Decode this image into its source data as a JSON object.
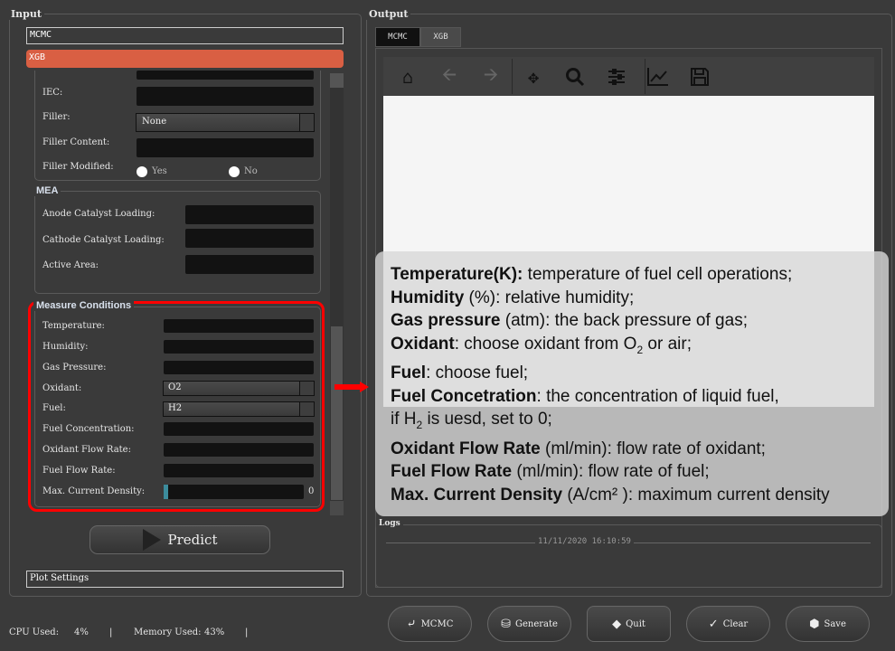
{
  "input": {
    "title": "Input",
    "models": [
      "MCMC",
      "XGB"
    ],
    "membrane": {
      "iec_label": "IEC:",
      "filler_label": "Filler:",
      "filler_value": "None",
      "filler_content_label": "Filler Content:",
      "filler_modified_label": "Filler Modified:",
      "yes": "Yes",
      "no": "No"
    },
    "mea": {
      "title": "MEA",
      "anode": "Anode Catalyst Loading:",
      "cathode": "Cathode Catalyst Loading:",
      "area": "Active Area:"
    },
    "measure": {
      "title": "Measure Conditions",
      "temperature": "Temperature:",
      "humidity": "Humidity:",
      "gas_pressure": "Gas Pressure:",
      "oxidant": "Oxidant:",
      "oxidant_value": "O2",
      "fuel": "Fuel:",
      "fuel_value": "H2",
      "fuel_conc": "Fuel Concentration:",
      "oxidant_flow": "Oxidant Flow Rate:",
      "fuel_flow": "Fuel Flow Rate:",
      "max_cd": "Max. Current Density:",
      "max_cd_value": "0"
    },
    "predict": "Predict",
    "plot_settings": "Plot Settings"
  },
  "status": {
    "cpu_label": "CPU Used:",
    "cpu": "4%",
    "mem_label": "Memory Used:",
    "mem": "43%",
    "sep": "|"
  },
  "output": {
    "title": "Output",
    "tabs": [
      "MCMC",
      "XGB"
    ],
    "logs_title": "Logs",
    "log_time": "11/11/2020 16:10:59",
    "toolbar": [
      "home-icon",
      "back-icon",
      "forward-icon",
      "pan-icon",
      "zoom-icon",
      "configure-icon",
      "axes-icon",
      "save-icon"
    ]
  },
  "buttons": {
    "mcmc": "MCMC",
    "generate": "Generate",
    "quit": "Quit",
    "clear": "Clear",
    "save": "Save"
  },
  "help": {
    "l1b": "Temperature(K):",
    "l1": " temperature of fuel cell operations;",
    "l2b": "Humidity",
    "l2": " (%): relative humidity;",
    "l3b": "Gas pressure",
    "l3": " (atm): the back pressure of gas;",
    "l4b": "Oxidant",
    "l4": ": choose oxidant from O",
    "l4s": "2",
    "l4e": " or air;",
    "l5b": "Fuel",
    "l5": ": choose fuel;",
    "l6b": "Fuel Concetration",
    "l6": ": the concentration of  liquid fuel,",
    "l7": "if H",
    "l7s": "2",
    "l7e": " is uesd, set to 0;",
    "l8b": "Oxidant Flow Rate",
    "l8": " (ml/min): flow rate of oxidant;",
    "l9b": "Fuel Flow Rate",
    "l9": " (ml/min): flow rate of fuel;",
    "l10b": "Max. Current Density",
    "l10": " (A/cm² ): maximum current density"
  },
  "colors": {
    "accent": "#d95f43",
    "highlight": "#ff0000",
    "progress": "#3c8c9c"
  }
}
